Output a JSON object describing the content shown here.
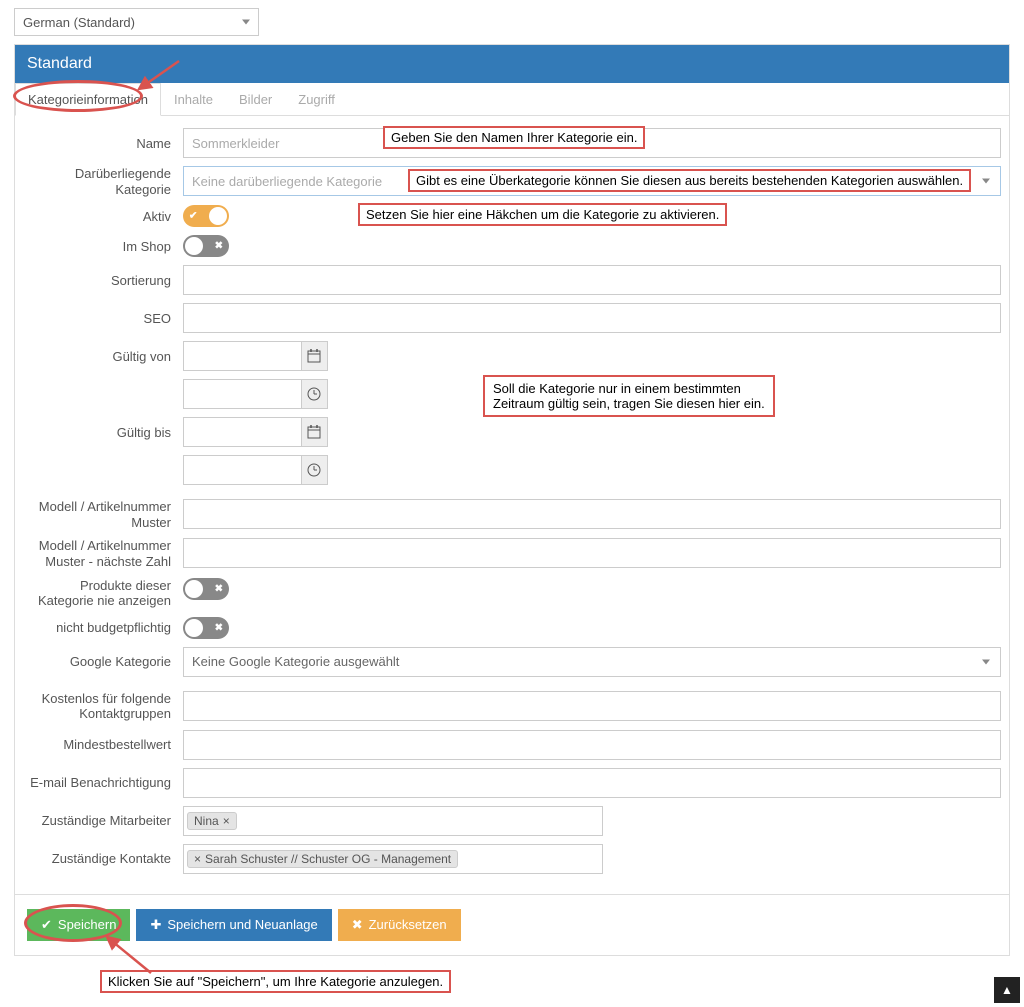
{
  "lang": {
    "selected": "German (Standard)"
  },
  "panel": {
    "title": "Standard"
  },
  "tabs": {
    "t0": "Kategorieinformation",
    "t1": "Inhalte",
    "t2": "Bilder",
    "t3": "Zugriff"
  },
  "labels": {
    "name": "Name",
    "parent": "Darüberliegende Kategorie",
    "active": "Aktiv",
    "inshop": "Im Shop",
    "sort": "Sortierung",
    "seo": "SEO",
    "validfrom": "Gültig von",
    "validto": "Gültig bis",
    "modelpattern": "Modell / Artikelnummer Muster",
    "modelpattern_next": "Modell / Artikelnummer Muster - nächste Zahl",
    "hideproducts": "Produkte dieser Kategorie nie anzeigen",
    "nobudget": "nicht budgetpflichtig",
    "google": "Google Kategorie",
    "freecontact": "Kostenlos für folgende Kontaktgruppen",
    "minorder": "Mindestbestellwert",
    "emailnotif": "E-mail Benachrichtigung",
    "employees": "Zuständige Mitarbeiter",
    "contacts": "Zuständige Kontakte"
  },
  "fields": {
    "name_placeholder": "Sommerkleider",
    "parent_placeholder": "Keine darüberliegende Kategorie",
    "google_placeholder": "Keine Google Kategorie ausgewählt",
    "employee_tag": "Nina",
    "contact_tag": "Sarah Schuster // Schuster OG - Management"
  },
  "callouts": {
    "name": "Geben Sie den Namen Ihrer Kategorie ein.",
    "parent": "Gibt es eine Überkategorie können Sie diesen aus bereits bestehenden Kategorien auswählen.",
    "active": "Setzen Sie hier eine Häkchen um die Kategorie zu aktivieren.",
    "validity_l1": "Soll die Kategorie nur in einem bestimmten",
    "validity_l2": "Zeitraum gültig sein, tragen Sie diesen hier ein.",
    "save": "Klicken Sie auf \"Speichern\", um Ihre Kategorie anzulegen."
  },
  "buttons": {
    "save": "Speichern",
    "save_new": "Speichern und Neuanlage",
    "reset": "Zurücksetzen"
  },
  "icons": {
    "check": "✔",
    "plus": "✚",
    "times": "✖",
    "cal": "📅",
    "clock": "◔",
    "caret_up": "︽"
  }
}
